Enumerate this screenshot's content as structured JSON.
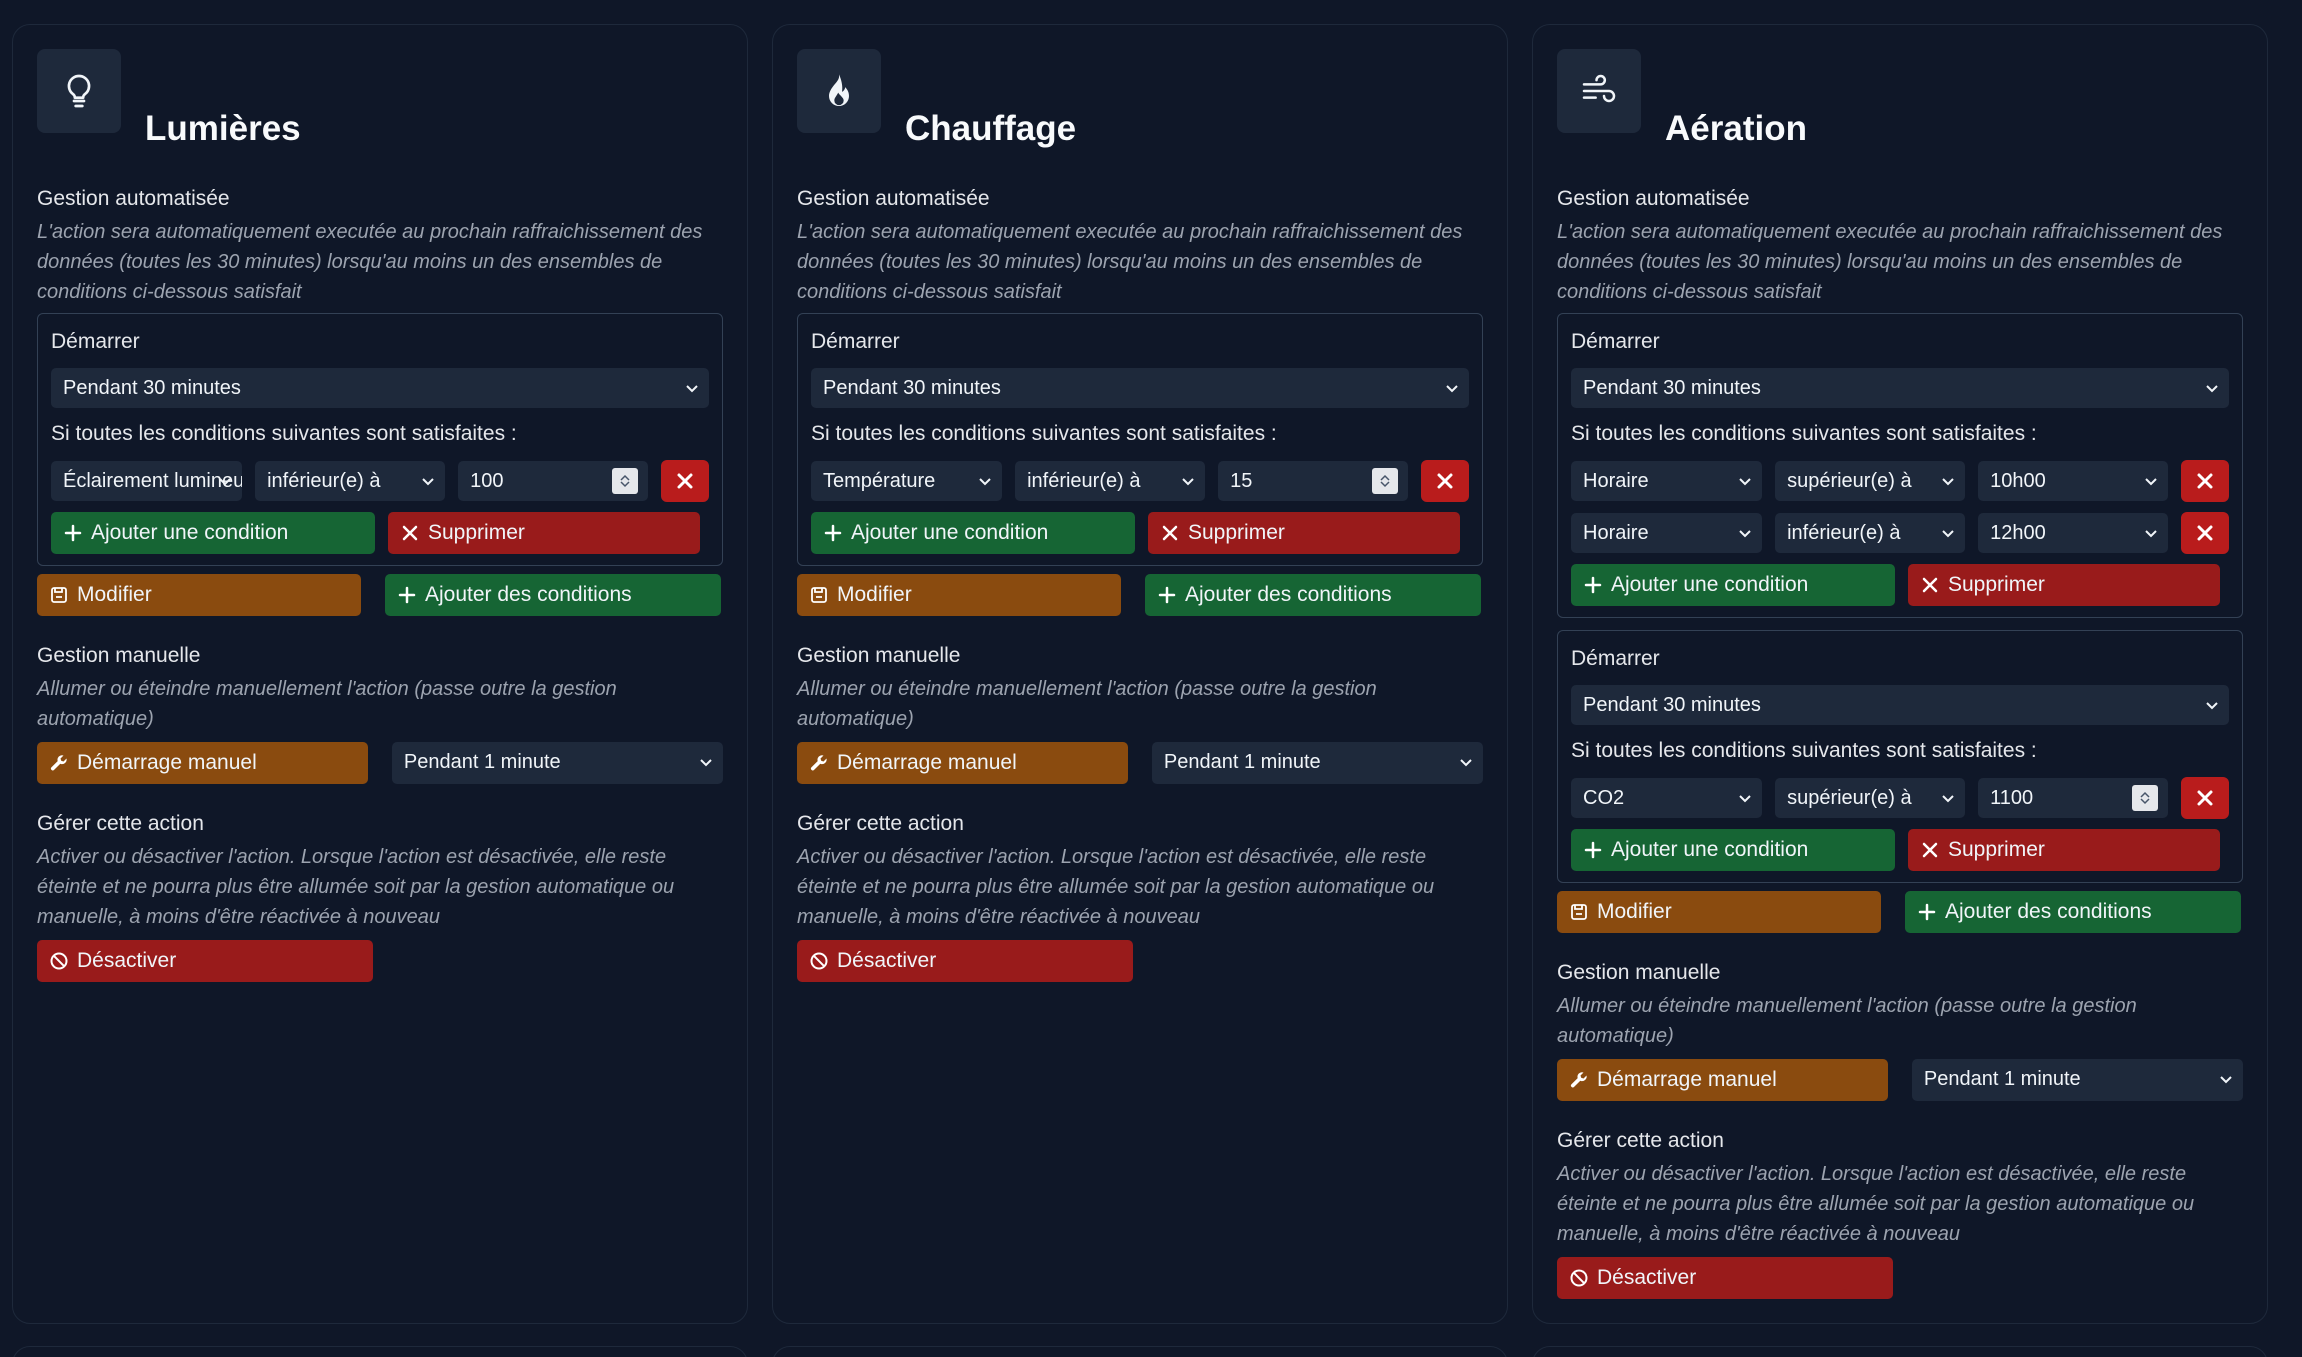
{
  "common": {
    "auto_title": "Gestion automatisée",
    "auto_desc": "L'action sera automatiquement executée au prochain raffraichissement des données (toutes les 30 minutes) lorsqu'au moins un des ensembles de conditions ci-dessous satisfait",
    "start_label": "Démarrer",
    "conditions_label": "Si toutes les conditions suivantes sont satisfaites :",
    "add_condition": "Ajouter une condition",
    "delete": "Supprimer",
    "modify": "Modifier",
    "add_conditions": "Ajouter des conditions",
    "manual_title": "Gestion manuelle",
    "manual_desc": "Allumer ou éteindre manuellement l'action (passe outre la gestion automatique)",
    "manual_start": "Démarrage manuel",
    "manage_title": "Gérer cette action",
    "manage_desc": "Activer ou désactiver l'action. Lorsque l'action est désactivée, elle reste éteinte et ne pourra plus être allumée soit par la gestion automatique ou manuelle, à moins d'être réactivée à nouveau",
    "deactivate": "Désactiver"
  },
  "cards": [
    {
      "title": "Lumières",
      "icon": "lightbulb-icon",
      "manual_duration": "Pendant 1 minute",
      "groups": [
        {
          "duration": "Pendant 30 minutes",
          "conditions": [
            {
              "field": "Éclairement lumineux",
              "op": "inférieur(e) à",
              "value": "100",
              "value_type": "number"
            }
          ]
        }
      ]
    },
    {
      "title": "Chauffage",
      "icon": "flame-icon",
      "manual_duration": "Pendant 1 minute",
      "groups": [
        {
          "duration": "Pendant 30 minutes",
          "conditions": [
            {
              "field": "Température",
              "op": "inférieur(e) à",
              "value": "15",
              "value_type": "number"
            }
          ]
        }
      ]
    },
    {
      "title": "Aération",
      "icon": "wind-icon",
      "manual_duration": "Pendant 1 minute",
      "groups": [
        {
          "duration": "Pendant 30 minutes",
          "conditions": [
            {
              "field": "Horaire",
              "op": "supérieur(e) à",
              "value": "10h00",
              "value_type": "select"
            },
            {
              "field": "Horaire",
              "op": "inférieur(e) à",
              "value": "12h00",
              "value_type": "select"
            }
          ]
        },
        {
          "duration": "Pendant 30 minutes",
          "conditions": [
            {
              "field": "CO2",
              "op": "supérieur(e) à",
              "value": "1100",
              "value_type": "number"
            }
          ]
        }
      ]
    }
  ],
  "colors": {
    "background": "#0f1728",
    "green": "#166534",
    "red": "#991b1b",
    "orange": "#8a4b0f"
  }
}
